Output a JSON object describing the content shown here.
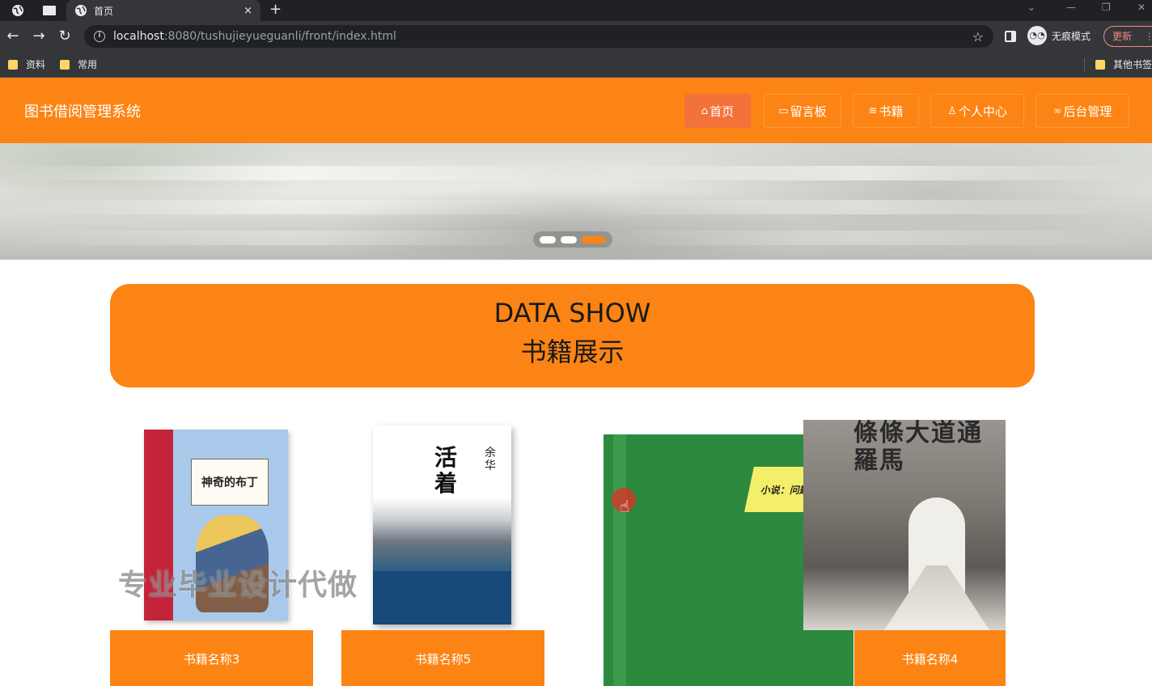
{
  "browser": {
    "tab_title": "首页",
    "tab_close": "×",
    "new_tab": "+",
    "url_host": "localhost",
    "url_rest": ":8080/tushujieyueguanli/front/index.html",
    "incognito_label": "无痕模式",
    "update_label": "更新",
    "bookmarks": [
      "资料",
      "常用"
    ],
    "other_bookmarks": "其他书签"
  },
  "site": {
    "title": "图书借阅管理系统",
    "nav": [
      {
        "label": "首页",
        "icon": "home-icon",
        "active": true
      },
      {
        "label": "留言板",
        "icon": "message-icon",
        "active": false
      },
      {
        "label": "书籍",
        "icon": "book-stack-icon",
        "active": false
      },
      {
        "label": "个人中心",
        "icon": "user-icon",
        "active": false
      },
      {
        "label": "后台管理",
        "icon": "link-icon",
        "active": false
      }
    ]
  },
  "carousel": {
    "slide_count": 3,
    "active_index": 2
  },
  "section": {
    "title_en": "DATA SHOW",
    "title_cn": "书籍展示"
  },
  "books": [
    {
      "label": "书籍名称3",
      "cover_title": "神奇的布丁"
    },
    {
      "label": "书籍名称5",
      "cover_title": "活着",
      "cover_author": "余华"
    },
    {
      "label": "",
      "cover_title": "小说：问题与方法"
    },
    {
      "label": "书籍名称4",
      "cover_title": "條條大道通羅馬"
    }
  ],
  "watermark": "专业毕业设计代做",
  "colors": {
    "brand": "#fc8414",
    "active_nav": "#f3723a"
  }
}
